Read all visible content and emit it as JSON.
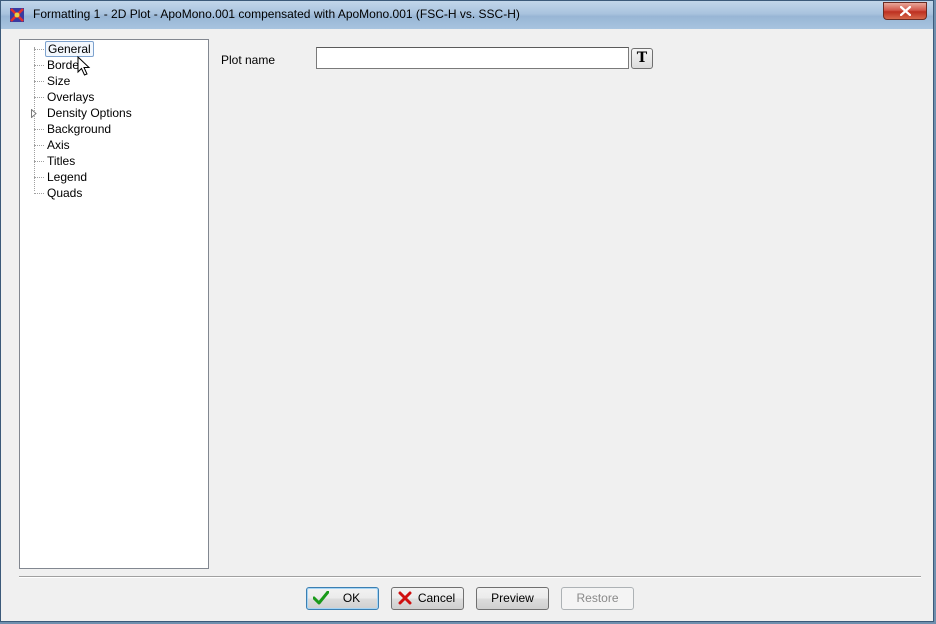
{
  "window": {
    "title": "Formatting 1 - 2D Plot - ApoMono.001 compensated with ApoMono.001 (FSC-H vs. SSC-H)"
  },
  "tree": {
    "items": [
      {
        "label": "General",
        "selected": true
      },
      {
        "label": "Border"
      },
      {
        "label": "Size"
      },
      {
        "label": "Overlays"
      },
      {
        "label": "Density Options",
        "expandable": true
      },
      {
        "label": "Background"
      },
      {
        "label": "Axis"
      },
      {
        "label": "Titles"
      },
      {
        "label": "Legend"
      },
      {
        "label": "Quads"
      }
    ]
  },
  "general": {
    "plot_name_label": "Plot name",
    "plot_name_value": "",
    "text_format_button": "T"
  },
  "buttons": {
    "ok": "OK",
    "cancel": "Cancel",
    "preview": "Preview",
    "restore": "Restore"
  },
  "icons": {
    "app": "app-icon",
    "close": "close-icon",
    "ok": "checkmark-icon",
    "cancel": "x-mark-icon"
  },
  "colors": {
    "close_button": "#c8432f",
    "ok_check": "#1a9a1a",
    "cancel_x": "#d01010",
    "selection_border": "#7da2ce"
  }
}
